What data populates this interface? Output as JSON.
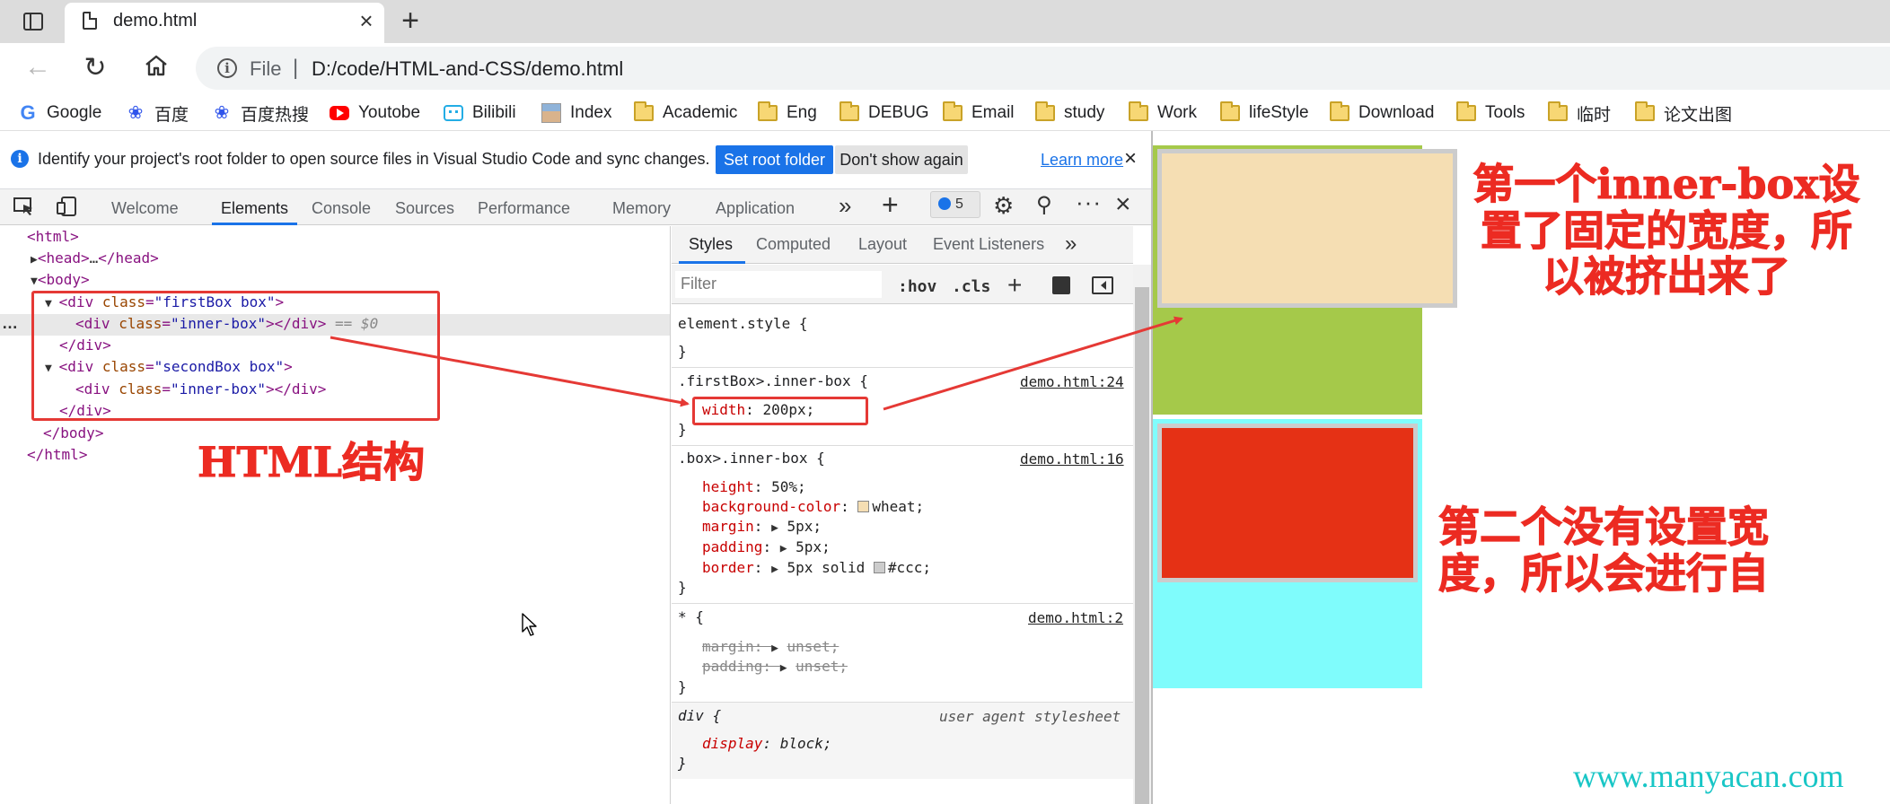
{
  "browser": {
    "tab_title": "demo.html",
    "tab_close": "×",
    "new_tab": "+",
    "url_scheme": "File",
    "url_separator": "|",
    "url": "D:/code/HTML-and-CSS/demo.html"
  },
  "bookmarks": [
    {
      "label": "Google",
      "icon": "google-icon"
    },
    {
      "label": "百度",
      "icon": "baidu-icon"
    },
    {
      "label": "百度热搜",
      "icon": "baidu-icon"
    },
    {
      "label": "Youtobe",
      "icon": "youtube-icon"
    },
    {
      "label": "Bilibili",
      "icon": "bilibili-icon"
    },
    {
      "label": "Index",
      "icon": "avatar-icon"
    },
    {
      "label": "Academic",
      "icon": "folder-icon"
    },
    {
      "label": "Eng",
      "icon": "folder-icon"
    },
    {
      "label": "DEBUG",
      "icon": "folder-icon"
    },
    {
      "label": "Email",
      "icon": "folder-icon"
    },
    {
      "label": "study",
      "icon": "folder-icon"
    },
    {
      "label": "Work",
      "icon": "folder-icon"
    },
    {
      "label": "lifeStyle",
      "icon": "folder-icon"
    },
    {
      "label": "Download",
      "icon": "folder-icon"
    },
    {
      "label": "Tools",
      "icon": "folder-icon"
    },
    {
      "label": "临时",
      "icon": "folder-icon"
    },
    {
      "label": "论文出图",
      "icon": "folder-icon"
    }
  ],
  "infobar": {
    "message": "Identify your project's root folder to open source files in Visual Studio Code and sync changes.",
    "set_root_label": "Set root folder",
    "dont_show_label": "Don't show again",
    "learn_more_label": "Learn more",
    "close": "×"
  },
  "devtools": {
    "tabs": [
      "Welcome",
      "Elements",
      "Console",
      "Sources",
      "Performance",
      "Memory",
      "Application"
    ],
    "active_tab": "Elements",
    "issues_count": "5",
    "more": "»",
    "add": "+",
    "close": "×",
    "menu": "···",
    "settings": "⚙",
    "share": "⚲"
  },
  "elements_tree": {
    "html_open": "html",
    "head_open": "head",
    "head_ellipsis": "…",
    "head_close": "/head",
    "body_open": "body",
    "div_tag": "div",
    "div_close": "/div",
    "class_attr": "class",
    "first_class": "\"firstBox box\"",
    "inner_class": "\"inner-box\"",
    "second_class": "\"secondBox box\"",
    "body_close": "/body",
    "html_close": "/html",
    "selected_marker": "== $0",
    "row_dots": "…"
  },
  "styles": {
    "tabs": [
      "Styles",
      "Computed",
      "Layout",
      "Event Listeners"
    ],
    "more": "»",
    "filter_placeholder": "Filter",
    "hov": ":hov",
    "cls": ".cls",
    "new_rule": "+",
    "rules": {
      "element_style": {
        "selector": "element.style {",
        "close": "}"
      },
      "first_inner": {
        "selector": ".firstBox>.inner-box {",
        "source": "demo.html:24",
        "prop": "width",
        "value": "200px;",
        "close": "}"
      },
      "box_inner": {
        "selector": ".box>.inner-box {",
        "source": "demo.html:16",
        "height_prop": "height",
        "height_val": "50%;",
        "bg_prop": "background-color",
        "bg_val": "wheat;",
        "bg_color": "#f5deb3",
        "margin_prop": "margin",
        "margin_val": "5px;",
        "padding_prop": "padding",
        "padding_val": "5px;",
        "border_prop": "border",
        "border_val_a": "5px solid",
        "border_val_b": "#ccc;",
        "border_color": "#cccccc",
        "close": "}"
      },
      "universal": {
        "selector": "* {",
        "source": "demo.html:2",
        "margin": "margin: ",
        "margin_val": "unset;",
        "padding": "padding: ",
        "padding_val": "unset;",
        "close": "}"
      },
      "ua_div": {
        "selector": "div {",
        "source": "user agent stylesheet",
        "prop": "display",
        "value": "block;",
        "close": "}"
      }
    }
  },
  "rendered_page": {
    "first_box_color": "#a5c94a",
    "first_inner_color": "#f5deb3",
    "second_box_color": "#7ffcfc",
    "second_inner_color": "#e53115"
  },
  "annotations": {
    "html_structure": "HTML结构",
    "first_note": "第一个inner-box设置了固定的宽度，所以被挤出来了",
    "second_note": "第二个没有设置宽度，所以会进行自",
    "watermark": "www.manyacan.com"
  }
}
